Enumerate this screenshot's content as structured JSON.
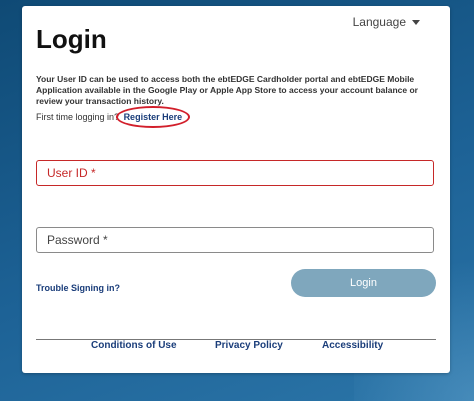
{
  "header": {
    "language_label": "Language"
  },
  "page": {
    "title": "Login",
    "description": "Your User ID can be used to access both the ebtEDGE Cardholder portal and ebtEDGE Mobile Application available in the Google Play or Apple App Store to access your account balance or review your transaction history.",
    "first_time_text": "First time logging in?",
    "register_link": "Register Here"
  },
  "form": {
    "user_id_placeholder": "User ID *",
    "password_placeholder": "Password *",
    "trouble_link": "Trouble Signing in?",
    "login_button": "Login"
  },
  "footer": {
    "conditions": "Conditions of Use",
    "privacy": "Privacy Policy",
    "accessibility": "Accessibility"
  },
  "colors": {
    "background": "#1d6296",
    "link": "#1a3d7a",
    "error": "#c62828",
    "button": "#7fa7bd",
    "highlight": "#d21f2b"
  },
  "icons": {
    "language_dropdown": "caret-down-icon"
  }
}
